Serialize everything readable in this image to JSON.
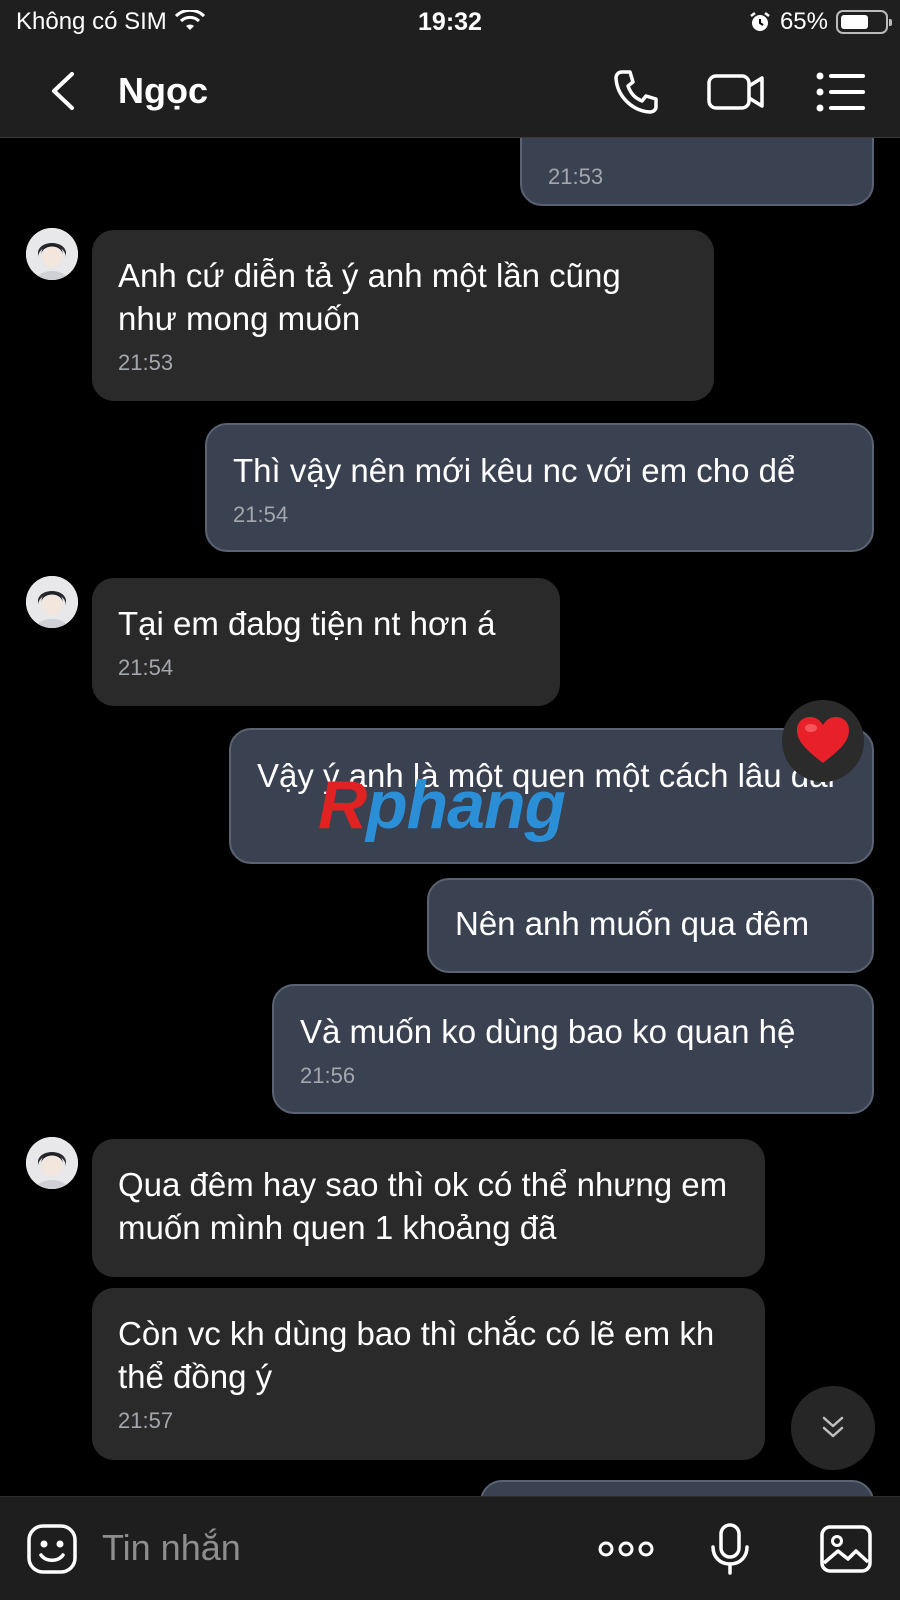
{
  "status_bar": {
    "carrier": "Không có SIM",
    "time": "19:32",
    "battery_percent": "65%",
    "battery_level": 0.65
  },
  "header": {
    "contact_name": "Ngọc"
  },
  "messages": [
    {
      "direction": "out",
      "text": "",
      "time": "21:53"
    },
    {
      "direction": "in",
      "text": "Anh cứ diễn tả ý anh một lần cũng như mong muốn",
      "time": "21:53"
    },
    {
      "direction": "out",
      "text": "Thì vậy nên mới kêu nc với em cho dể",
      "time": "21:54"
    },
    {
      "direction": "in",
      "text": "Tại em đabg tiện nt hơn á",
      "time": "21:54"
    },
    {
      "direction": "out",
      "text": "Vậy ý anh là một quen một cách lâu dài",
      "time": ""
    },
    {
      "direction": "out",
      "text": "Nên anh muốn qua đêm",
      "time": ""
    },
    {
      "direction": "out",
      "text": "Và muốn ko dùng bao ko quan hệ",
      "time": "21:56"
    },
    {
      "direction": "in",
      "text": "Qua đêm hay sao thì ok có thể nhưng em muốn mình quen 1 khoảng đã",
      "time": ""
    },
    {
      "direction": "in",
      "text": "Còn vc kh dùng bao thì chắc có lẽ em kh thể đồng ý",
      "time": "21:57"
    }
  ],
  "reaction": {
    "icon": "heart-icon",
    "color": "#e8202a"
  },
  "watermark": {
    "part1": "R",
    "part2": "phang"
  },
  "input": {
    "placeholder": "Tin nhắn"
  },
  "colors": {
    "incoming_bubble": "#2a2a2a",
    "outgoing_bubble": "#3a4150",
    "background": "#000000"
  }
}
